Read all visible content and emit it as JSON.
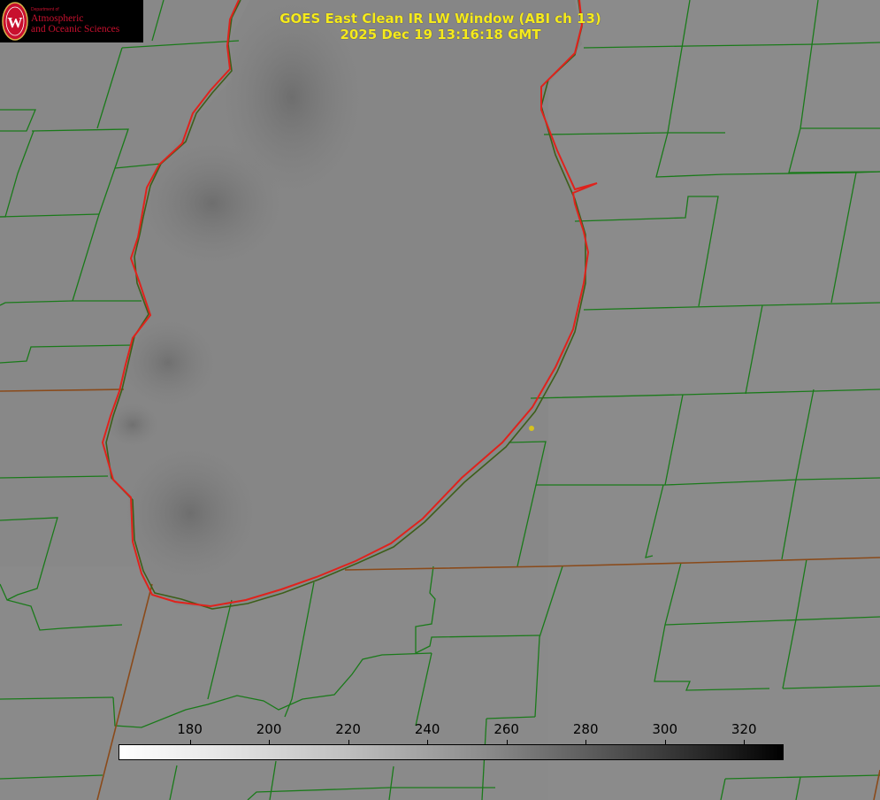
{
  "logo": {
    "dept_small": "Department of",
    "line1": "Atmospheric",
    "line2": "and Oceanic Sciences",
    "icon": "uw-crest-icon",
    "color": "#c8102e"
  },
  "title": {
    "line1": "GOES East Clean IR LW Window (ABI ch 13)",
    "line2": "2025 Dec 19 13:16:18 GMT",
    "color": "#f5ea1c"
  },
  "colorbar": {
    "ticks": [
      "180",
      "200",
      "220",
      "240",
      "260",
      "280",
      "300",
      "320"
    ],
    "min_value": 162,
    "max_value": 330,
    "low_color": "#ffffff",
    "high_color": "#000000"
  },
  "map": {
    "boundary_color": "#1a7a1a",
    "coastline_color": "#e0221c",
    "state_line_color": "#8a4a1a",
    "marker_color": "#d6c21e"
  }
}
